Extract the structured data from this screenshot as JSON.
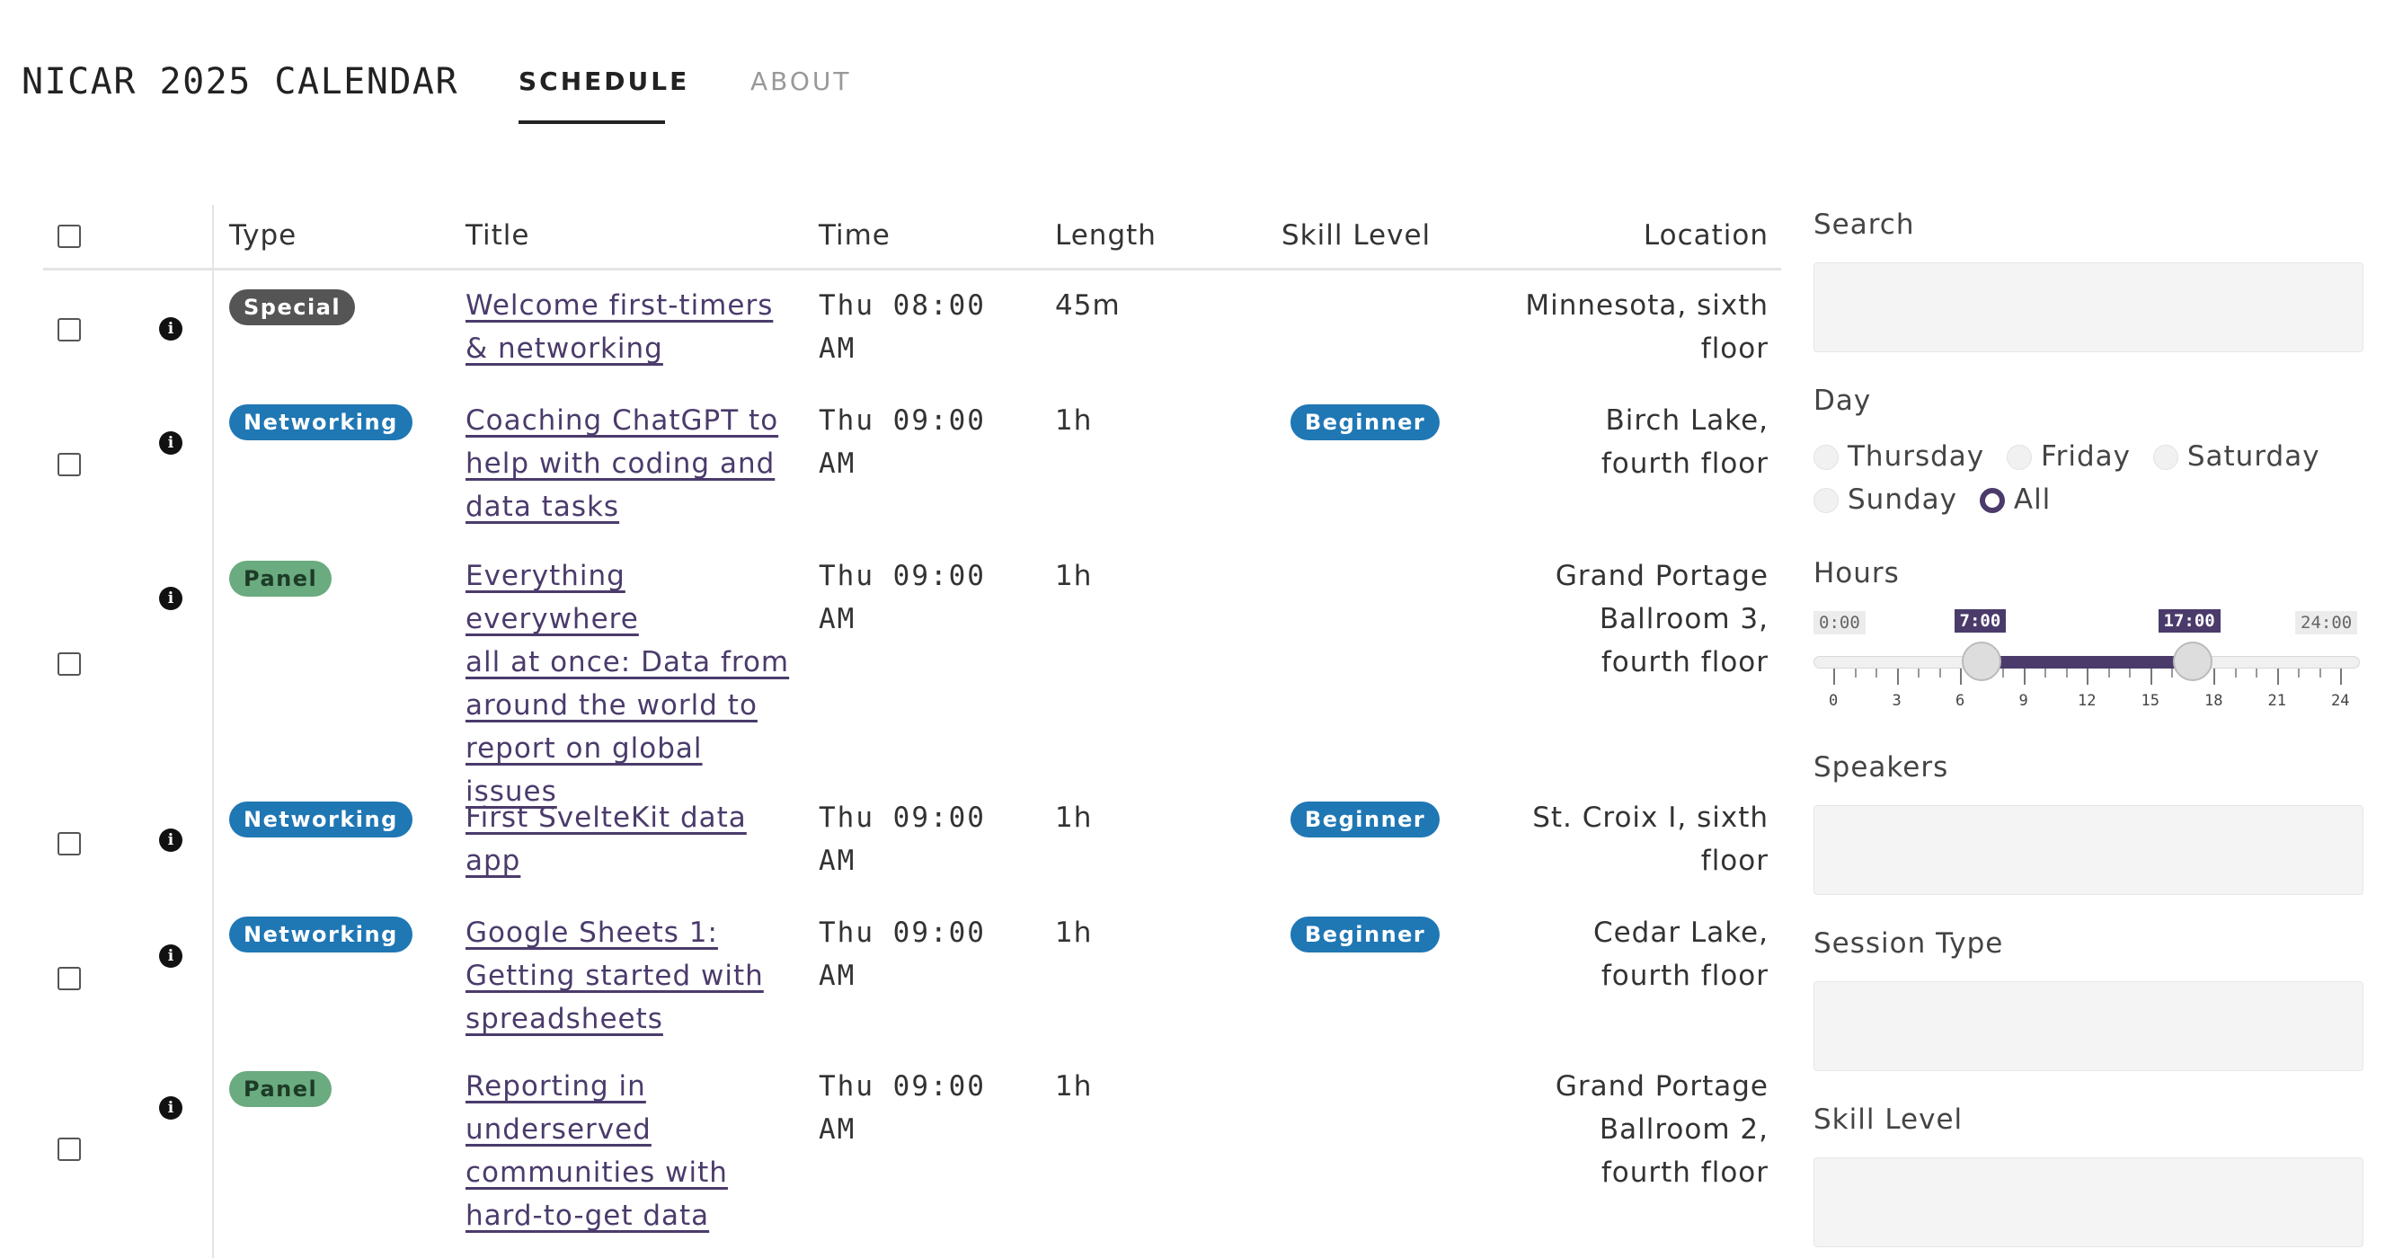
{
  "app": {
    "title": "NICAR 2025 CALENDAR"
  },
  "tabs": [
    {
      "label": "SCHEDULE",
      "active": true
    },
    {
      "label": "ABOUT",
      "active": false
    }
  ],
  "table": {
    "headers": [
      "Type",
      "Title",
      "Time",
      "Length",
      "Skill Level",
      "Location"
    ],
    "rows": [
      {
        "type": "Special",
        "title": [
          "Welcome first-timers",
          "& networking"
        ],
        "time": [
          "Thu 08:00",
          "AM"
        ],
        "length": "45m",
        "skill": "",
        "location": [
          "Minnesota, sixth",
          "floor"
        ]
      },
      {
        "type": "Networking",
        "title": [
          "Coaching ChatGPT to",
          "help with coding and",
          "data tasks"
        ],
        "time": [
          "Thu 09:00",
          "AM"
        ],
        "length": "1h",
        "skill": "Beginner",
        "location": [
          "Birch Lake,",
          "fourth floor"
        ]
      },
      {
        "type": "Panel",
        "title": [
          "Everything everywhere",
          "all at once: Data from",
          "around the world to",
          "report on global",
          "issues"
        ],
        "time": [
          "Thu 09:00",
          "AM"
        ],
        "length": "1h",
        "skill": "",
        "location": [
          "Grand Portage",
          "Ballroom 3,",
          "fourth floor"
        ]
      },
      {
        "type": "Networking",
        "title": [
          "First SvelteKit data",
          "app"
        ],
        "time": [
          "Thu 09:00",
          "AM"
        ],
        "length": "1h",
        "skill": "Beginner",
        "location": [
          "St. Croix I, sixth",
          "floor"
        ]
      },
      {
        "type": "Networking",
        "title": [
          "Google Sheets 1:",
          "Getting started with",
          "spreadsheets"
        ],
        "time": [
          "Thu 09:00",
          "AM"
        ],
        "length": "1h",
        "skill": "Beginner",
        "location": [
          "Cedar Lake,",
          "fourth floor"
        ]
      },
      {
        "type": "Panel",
        "title": [
          "Reporting in",
          "underserved",
          "communities with",
          "hard-to-get data"
        ],
        "time": [
          "Thu 09:00",
          "AM"
        ],
        "length": "1h",
        "skill": "",
        "location": [
          "Grand Portage",
          "Ballroom 2,",
          "fourth floor"
        ]
      }
    ]
  },
  "sidebar": {
    "search_label": "Search",
    "day_label": "Day",
    "days": [
      "Thursday",
      "Friday",
      "Saturday",
      "Sunday",
      "All"
    ],
    "day_selected": "All",
    "hours_label": "Hours",
    "hours_min_label": "0:00",
    "hours_max_label": "24:00",
    "hours_start_label": "7:00",
    "hours_end_label": "17:00",
    "hours_start": 7,
    "hours_end": 17,
    "hours_ticks": [
      "0",
      "3",
      "6",
      "9",
      "12",
      "15",
      "18",
      "21",
      "24"
    ],
    "speakers_label": "Speakers",
    "session_type_label": "Session Type",
    "skill_level_label": "Skill Level"
  },
  "colors": {
    "accent": "#4b3b6b",
    "networking": "#1f77b4",
    "panel": "#6aab7f",
    "special": "#555555",
    "beginner": "#1f77b4"
  }
}
